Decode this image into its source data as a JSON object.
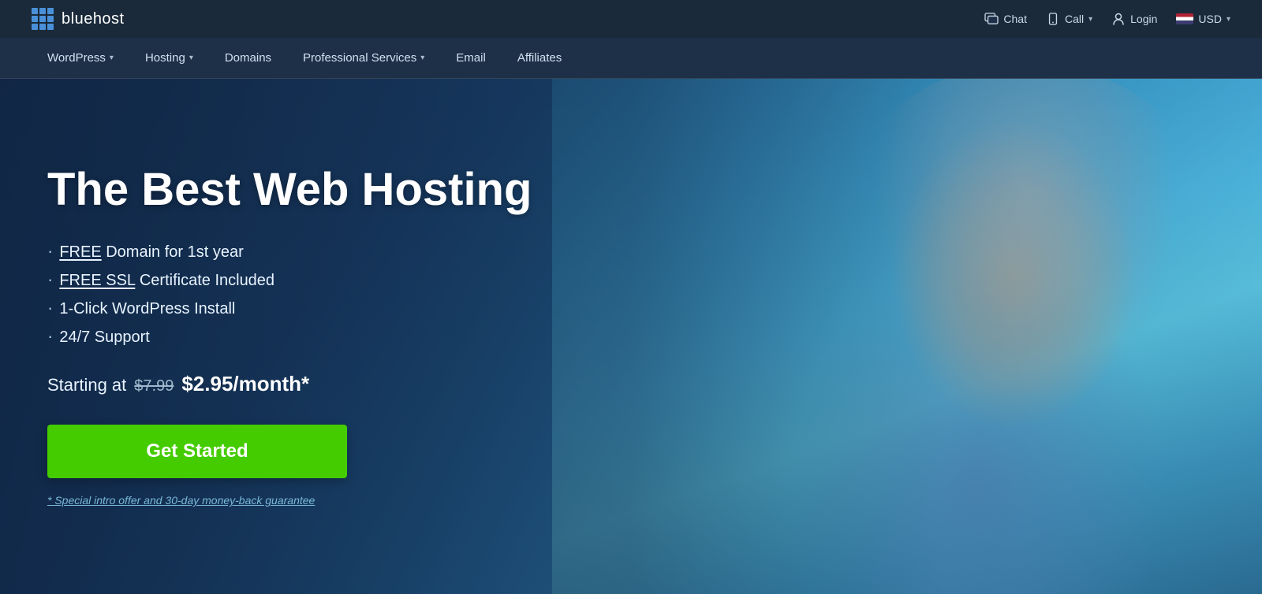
{
  "brand": {
    "name": "bluehost"
  },
  "topBar": {
    "chat_label": "Chat",
    "call_label": "Call",
    "login_label": "Login",
    "currency_label": "USD"
  },
  "nav": {
    "items": [
      {
        "label": "WordPress",
        "has_dropdown": true
      },
      {
        "label": "Hosting",
        "has_dropdown": true
      },
      {
        "label": "Domains",
        "has_dropdown": false
      },
      {
        "label": "Professional Services",
        "has_dropdown": true
      },
      {
        "label": "Email",
        "has_dropdown": false
      },
      {
        "label": "Affiliates",
        "has_dropdown": false
      }
    ]
  },
  "hero": {
    "title": "The Best Web Hosting",
    "features": [
      {
        "highlight": "FREE",
        "rest": " Domain for 1st year"
      },
      {
        "highlight": "FREE SSL",
        "rest": " Certificate Included"
      },
      {
        "highlight": "",
        "rest": "1-Click WordPress Install"
      },
      {
        "highlight": "",
        "rest": "24/7 Support"
      }
    ],
    "pricing_prefix": "Starting at",
    "old_price": "$7.99",
    "new_price": "$2.95/month*",
    "cta_label": "Get Started",
    "disclaimer": "* Special intro offer and 30-day money-back guarantee"
  }
}
